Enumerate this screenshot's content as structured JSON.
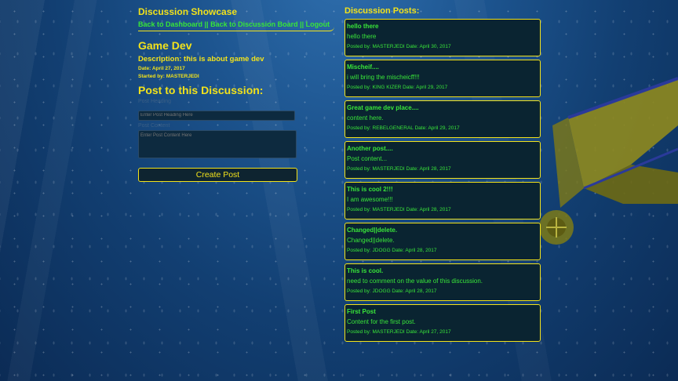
{
  "header": {
    "site_title": "Discussion Showcase",
    "nav": {
      "dashboard": "Back to Dashboard",
      "sep1": " || ",
      "board": "Back to Discussion Board",
      "sep2": " || ",
      "logout": "Logout"
    }
  },
  "discussion": {
    "title": "Game Dev",
    "description": "Description: this is about game dev",
    "date": "Date: April 27, 2017",
    "started_by": "Started by: MASTERJEDI"
  },
  "form": {
    "heading": "Post to this Discussion:",
    "heading_label": "Post Heading",
    "heading_placeholder": "Enter Post Heading Here",
    "content_label": "Post Content",
    "content_placeholder": "Enter Post Content Here",
    "submit_label": "Create Post"
  },
  "posts_title": "Discussion Posts:",
  "posts": [
    {
      "heading": "hello there",
      "content": "hello there",
      "meta": "Posted by: MASTERJEDI Date: April 30, 2017"
    },
    {
      "heading": "Mischeif....",
      "content": "i will bring the mischeicff!!!",
      "meta": "Posted by: KING KIZER Date: April 29, 2017"
    },
    {
      "heading": "Great game dev place....",
      "content": "content here.",
      "meta": "Posted by: REBELGENERAL Date: April 29, 2017"
    },
    {
      "heading": "Another post....",
      "content": "Post content...",
      "meta": "Posted by: MASTERJEDI Date: April 28, 2017"
    },
    {
      "heading": "This is cool 2!!!",
      "content": "I am awesome!!!",
      "meta": "Posted by: MASTERJEDI Date: April 28, 2017"
    },
    {
      "heading": "Changed||delete.",
      "content": "Changed||delete.",
      "meta": "Posted by: JDOGG Date: April 28, 2017"
    },
    {
      "heading": "This is cool.",
      "content": "need to comment on the value of this discussion.",
      "meta": "Posted by: JDOGG Date: April 28, 2017"
    },
    {
      "heading": "First Post",
      "content": "Content for the first post.",
      "meta": "Posted by: MASTERJEDI Date: April 27, 2017"
    }
  ],
  "colors": {
    "accent_yellow": "#f2e21b",
    "text_green": "#39e639",
    "panel_bg": "#0a2431"
  },
  "icons": {
    "background": "underwater-airplane-scene"
  }
}
